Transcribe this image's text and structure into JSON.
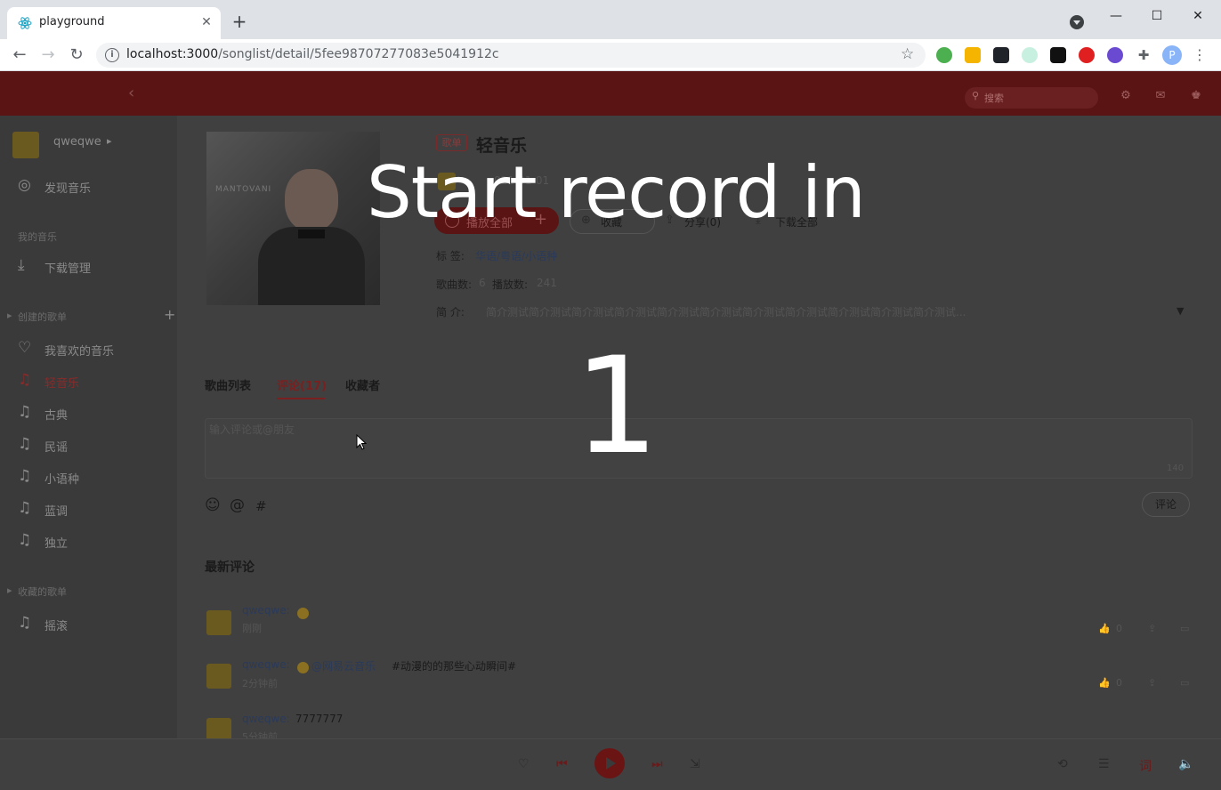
{
  "browser": {
    "tab_title": "playground",
    "url_host": "localhost:3000",
    "url_path": "/songlist/detail/5fee98707277083e5041912c",
    "profile_initial": "P"
  },
  "header": {
    "search_placeholder": "搜索"
  },
  "sidebar": {
    "username": "qweqwe",
    "discover": "发现音乐",
    "my_music_label": "我的音乐",
    "downloads": "下载管理",
    "created_label": "创建的歌单",
    "created_add": "+",
    "created_items": [
      {
        "label": "我喜欢的音乐",
        "icon": "heart-icon"
      },
      {
        "label": "轻音乐",
        "icon": "music-note-icon"
      },
      {
        "label": "古典",
        "icon": "music-note-icon"
      },
      {
        "label": "民谣",
        "icon": "music-note-icon"
      },
      {
        "label": "小语种",
        "icon": "music-note-icon"
      },
      {
        "label": "蓝调",
        "icon": "music-note-icon"
      },
      {
        "label": "独立",
        "icon": "music-note-icon"
      }
    ],
    "collected_label": "收藏的歌单",
    "collected_items": [
      {
        "label": "摇滚",
        "icon": "music-note-icon"
      }
    ]
  },
  "playlist": {
    "badge": "歌单",
    "title": "轻音乐",
    "cover_text": "MANTOVANI",
    "creator_date": "021-01-01",
    "play_all": "播放全部",
    "collect": "收藏",
    "share": "分享(0)",
    "download_all": "下载全部",
    "tags_label": "标  签:",
    "tags_value": "华语/粤语/小语种",
    "songcount_label": "歌曲数:",
    "songcount_value": "6",
    "playcount_label": "播放数:",
    "playcount_value": "241",
    "desc_label": "简    介:",
    "desc_value": "简介测试简介测试简介测试简介测试简介测试简介测试简介测试简介测试简介测试简介测试简介测试..."
  },
  "tabs": [
    {
      "label": "歌曲列表",
      "active": false
    },
    {
      "label": "评论(17)",
      "active": true
    },
    {
      "label": "收藏者",
      "active": false
    }
  ],
  "comment_input": {
    "placeholder": "输入评论或@朋友",
    "remaining": "140",
    "submit": "评论"
  },
  "latest_heading": "最新评论",
  "comments": [
    {
      "user": "qweqwe:",
      "text": "",
      "link": "",
      "time": "刚刚",
      "likes": "0"
    },
    {
      "user": "qweqwe:",
      "text": "#动漫的的那些心动瞬间#",
      "link": "@网易云音乐",
      "time": "2分钟前",
      "likes": "0"
    },
    {
      "user": "qweqwe:",
      "text": "7777777",
      "link": "",
      "time": "5分钟前",
      "likes": "0"
    }
  ],
  "overlay": {
    "title": "Start record in",
    "count": "1"
  },
  "player": {
    "lyric": "词"
  },
  "colors": {
    "brand_red": "#c20c0c",
    "overlay_text": "#ffffff"
  }
}
